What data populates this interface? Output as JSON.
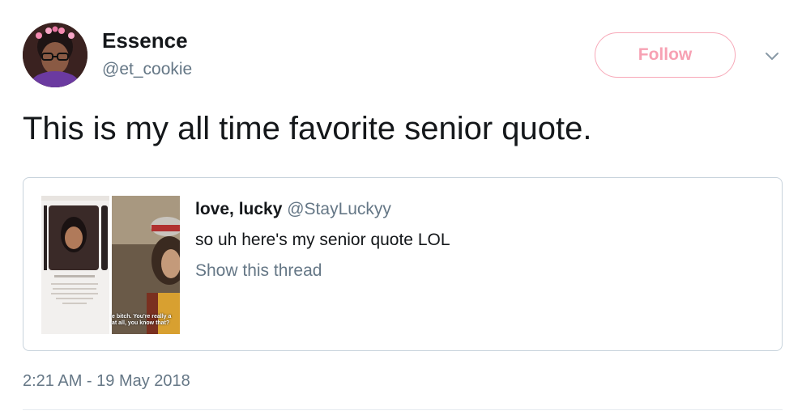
{
  "author": {
    "display_name": "Essence",
    "handle": "@et_cookie"
  },
  "follow_button": {
    "label": "Follow"
  },
  "tweet": {
    "text": "This is my all time favorite senior quote.",
    "timestamp": "2:21 AM - 19 May 2018"
  },
  "quoted_tweet": {
    "display_name": "love, lucky",
    "handle": "@StayLuckyy",
    "text": "so uh here's my senior quote LOL",
    "show_thread_label": "Show this thread",
    "media_caption_lines": [
      "e bitch. You're really a",
      "at all, you know that?"
    ]
  },
  "icons": {
    "menu": "chevron-down-icon",
    "avatar": "avatar-image"
  },
  "colors": {
    "follow_accent": "#f7a1b3",
    "secondary_text": "#657786",
    "card_border": "#c8d3dc"
  }
}
